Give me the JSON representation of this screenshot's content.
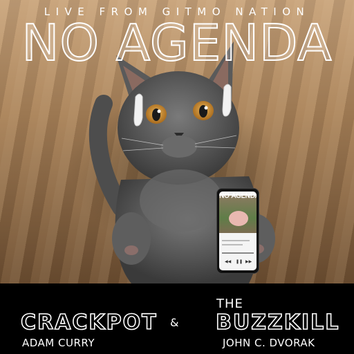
{
  "header": {
    "tagline": "LIVE FROM GITMO NATION",
    "title": "NO AGENDA"
  },
  "phone": {
    "screen_title": "NO AGENDA"
  },
  "hosts": {
    "left": {
      "nickname": "CRACKPOT",
      "name": "ADAM CURRY"
    },
    "connector": "&",
    "right": {
      "prefix": "THE",
      "nickname": "BUZZKILL",
      "name": "JOHN C. DVORAK"
    }
  },
  "colors": {
    "band": "#000000",
    "text": "#ffffff",
    "wood": "#a98259",
    "cat_fur": "#5b5b5b",
    "eyes": "#c98a2a"
  }
}
